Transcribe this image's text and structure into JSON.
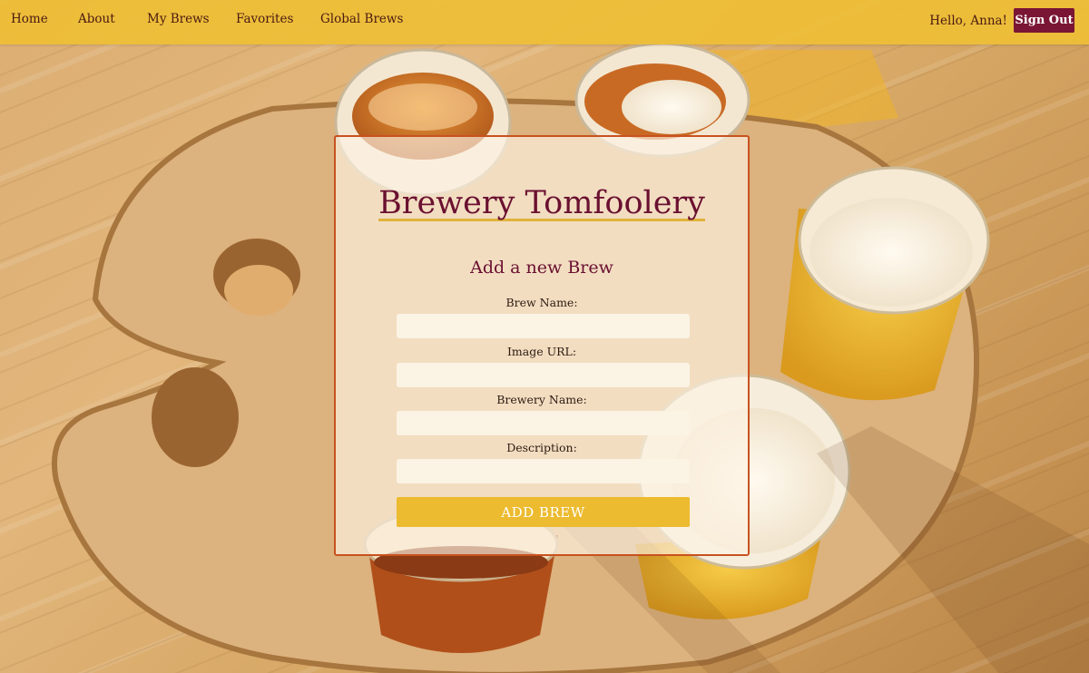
{
  "nav": {
    "links": [
      "Home",
      "About",
      "My Brews",
      "Favorites",
      "Global Brews"
    ],
    "greeting": "Hello, Anna!",
    "signout_label": "Sign Out"
  },
  "form": {
    "app_title": "Brewery Tomfoolery",
    "heading": "Add a new Brew",
    "fields": [
      {
        "label": "Brew Name:",
        "value": ""
      },
      {
        "label": "Image URL:",
        "value": ""
      },
      {
        "label": "Brewery Name:",
        "value": ""
      },
      {
        "label": "Description:",
        "value": ""
      }
    ],
    "submit_label": "ADD BREW"
  },
  "colors": {
    "navbar": "#eebe36",
    "accent_maroon": "#7a1535",
    "title_color": "#6a1030",
    "card_border": "#c8521f",
    "submit_button": "#ecbb2f"
  },
  "background": {
    "icon": "beer-flight-photo"
  }
}
